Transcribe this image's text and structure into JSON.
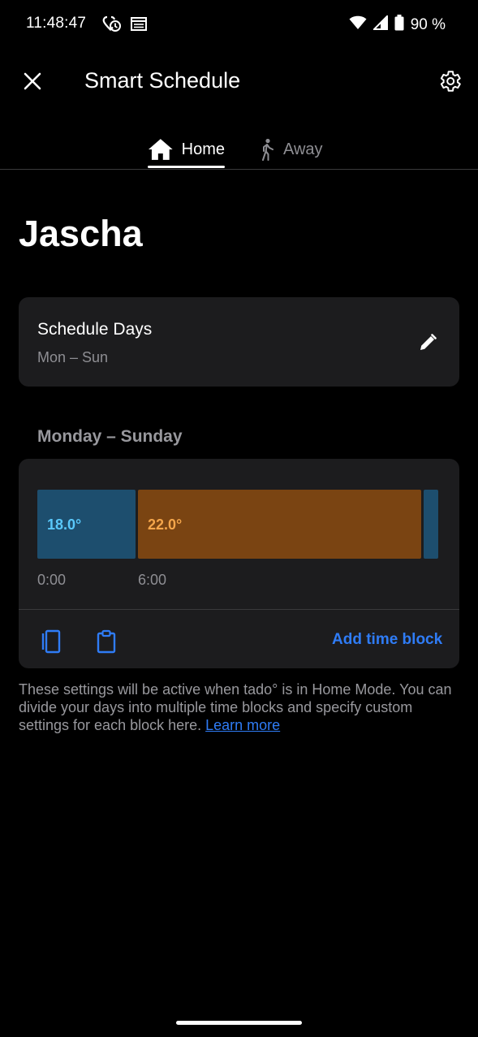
{
  "status_bar": {
    "time": "11:48:47",
    "battery": "90 %"
  },
  "app_bar": {
    "title": "Smart Schedule"
  },
  "tabs": [
    {
      "label": "Home",
      "icon": "home-icon",
      "selected": true
    },
    {
      "label": "Away",
      "icon": "walking-person-icon",
      "selected": false
    }
  ],
  "room_name": "Jascha",
  "schedule_days": {
    "title": "Schedule Days",
    "value": "Mon – Sun"
  },
  "day_range_title": "Monday – Sunday",
  "timeline": {
    "blocks": [
      {
        "label": "18.0°",
        "start": "0:00",
        "end": "6:00",
        "color": "#1d4e6e",
        "text_color": "#5ac8fa"
      },
      {
        "label": "22.0°",
        "start": "6:00",
        "end": "23:30",
        "color": "#7a4412",
        "text_color": "#f4a64b"
      },
      {
        "label": "",
        "start": "23:30",
        "end": "24:00",
        "color": "#1d4e6e",
        "text_color": "#5ac8fa"
      }
    ],
    "ticks": [
      "0:00",
      "6:00"
    ]
  },
  "actions": {
    "add_time_block": "Add time block"
  },
  "info": {
    "text": "These settings will be active when tado° is in Home Mode. You can divide your days into multiple time blocks and specify custom settings for each block here. ",
    "link": "Learn more"
  },
  "colors": {
    "accent": "#2f7cf6",
    "card": "#1c1c1e",
    "cool_block": "#1d4e6e",
    "warm_block": "#7a4412"
  }
}
